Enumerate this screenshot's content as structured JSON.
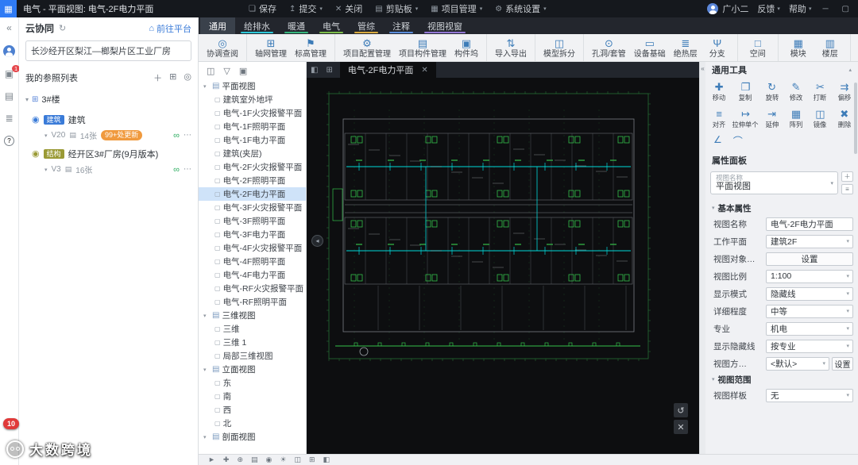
{
  "title_bar": {
    "title": "电气 - 平面视图: 电气-2F电力平面",
    "menu": [
      {
        "label": "保存",
        "icon": "save-icon",
        "caret": false
      },
      {
        "label": "提交",
        "icon": "submit-icon",
        "caret": true
      },
      {
        "label": "关闭",
        "icon": "close-doc-icon",
        "caret": false
      },
      {
        "label": "剪贴板",
        "icon": "clipboard-icon",
        "caret": true
      },
      {
        "label": "项目管理",
        "icon": "project-manage-icon",
        "caret": true
      },
      {
        "label": "系统设置",
        "icon": "system-settings-icon",
        "caret": true
      }
    ],
    "user": "广小二",
    "feedback": "反馈",
    "help": "帮助"
  },
  "ribbon": {
    "tabs": [
      {
        "label": "通用",
        "active": true,
        "underline": ""
      },
      {
        "label": "给排水",
        "active": false,
        "underline": "#2ec8d8"
      },
      {
        "label": "暖通",
        "active": false,
        "underline": "#35b57c"
      },
      {
        "label": "电气",
        "active": false,
        "underline": "#7cbd4a"
      },
      {
        "label": "管综",
        "active": false,
        "underline": "#d8aa3e"
      },
      {
        "label": "注释",
        "active": false,
        "underline": "#5b8ddb"
      },
      {
        "label": "视图视窗",
        "active": false,
        "underline": "#9377d6"
      }
    ],
    "groups": [
      [
        {
          "label": "协调查阅",
          "icon": "coordination-review-icon"
        }
      ],
      [
        {
          "label": "轴网管理",
          "icon": "grid-manage-icon"
        },
        {
          "label": "标高管理",
          "icon": "elevation-manage-icon"
        }
      ],
      [
        {
          "label": "项目配置管理",
          "icon": "project-config-icon"
        },
        {
          "label": "项目构件管理",
          "icon": "project-component-icon"
        },
        {
          "label": "构件坞",
          "icon": "component-dock-icon"
        }
      ],
      [
        {
          "label": "导入导出",
          "icon": "import-export-icon"
        }
      ],
      [
        {
          "label": "模型拆分",
          "icon": "model-split-icon"
        }
      ],
      [
        {
          "label": "孔洞/套管",
          "icon": "hole-sleeve-icon"
        },
        {
          "label": "设备基础",
          "icon": "equipment-base-icon"
        },
        {
          "label": "绝热层",
          "icon": "insulation-icon"
        },
        {
          "label": "分支",
          "icon": "branch-icon"
        }
      ],
      [
        {
          "label": "空间",
          "icon": "space-icon"
        }
      ],
      [
        {
          "label": "模块",
          "icon": "module-icon"
        },
        {
          "label": "楼层",
          "icon": "floor-icon"
        }
      ]
    ]
  },
  "left_strip": {
    "model_badge": "1"
  },
  "cloud_panel": {
    "header": "云协同",
    "go_platform": "前往平台",
    "project_name": "长沙经开区梨江—榔梨片区工业厂房",
    "ref_list_title": "我的参照列表",
    "root": "3#楼",
    "items": [
      {
        "tag": "建筑",
        "tag_color": "#3a7bd8",
        "name": "建筑",
        "version": "V20",
        "sheets": "14张",
        "badge": "99+处更新"
      },
      {
        "tag": "结构",
        "tag_color": "#9a9a35",
        "name": "经开区3#厂房(9月版本)",
        "version": "V3",
        "sheets": "16张",
        "badge": ""
      }
    ]
  },
  "view_tree": {
    "sections": [
      {
        "label": "平面视图",
        "selected": 7,
        "items": [
          "建筑室外地坪",
          "电气-1F火灾报警平面",
          "电气-1F照明平面",
          "电气-1F电力平面",
          "建筑(夹层)",
          "电气-2F火灾报警平面",
          "电气-2F照明平面",
          "电气-2F电力平面",
          "电气-3F火灾报警平面",
          "电气-3F照明平面",
          "电气-3F电力平面",
          "电气-4F火灾报警平面",
          "电气-4F照明平面",
          "电气-4F电力平面",
          "电气-RF火灾报警平面",
          "电气-RF照明平面"
        ]
      },
      {
        "label": "三维视图",
        "selected": -1,
        "items": [
          "三维",
          "三维 1",
          "局部三维视图"
        ]
      },
      {
        "label": "立面视图",
        "selected": -1,
        "items": [
          "东",
          "南",
          "西",
          "北"
        ]
      },
      {
        "label": "剖面视图",
        "selected": -1,
        "items": []
      }
    ]
  },
  "canvas": {
    "tab": "电气-2F电力平面"
  },
  "tools_panel": {
    "header": "通用工具",
    "tools": [
      {
        "label": "移动",
        "icon": "move-icon"
      },
      {
        "label": "复制",
        "icon": "copy-icon"
      },
      {
        "label": "旋转",
        "icon": "rotate-icon"
      },
      {
        "label": "修改",
        "icon": "modify-icon"
      },
      {
        "label": "打断",
        "icon": "break-icon"
      },
      {
        "label": "偏移",
        "icon": "offset-icon"
      },
      {
        "label": "对齐",
        "icon": "align-icon"
      },
      {
        "label": "拉伸单个",
        "icon": "stretch-single-icon"
      },
      {
        "label": "延伸",
        "icon": "extend-icon"
      },
      {
        "label": "阵列",
        "icon": "array-icon"
      },
      {
        "label": "镜像",
        "icon": "mirror-icon"
      },
      {
        "label": "删除",
        "icon": "delete-icon"
      }
    ]
  },
  "properties_panel": {
    "header": "属性面板",
    "selector_label": "视图名称",
    "selector_value": "平面视图",
    "section_basic": "基本属性",
    "rows": [
      {
        "label": "视图名称",
        "value": "电气-2F电力平面",
        "type": "text"
      },
      {
        "label": "工作平面",
        "value": "建筑2F",
        "type": "select"
      },
      {
        "label": "视图对象…",
        "value": "设置",
        "type": "button"
      },
      {
        "label": "视图比例",
        "value": "1:100",
        "type": "select"
      },
      {
        "label": "显示模式",
        "value": "隐藏线",
        "type": "select"
      },
      {
        "label": "详细程度",
        "value": "中等",
        "type": "select"
      },
      {
        "label": "专业",
        "value": "机电",
        "type": "select"
      },
      {
        "label": "显示隐藏线",
        "value": "按专业",
        "type": "select"
      },
      {
        "label": "视图方…",
        "value": "<默认>",
        "type": "select-button",
        "button": "设置"
      }
    ],
    "section_range": "视图范围",
    "rows2": [
      {
        "label": "视图样板",
        "value": "无",
        "type": "select"
      }
    ]
  },
  "status_bar": {
    "icons": [
      "cursor-icon",
      "pan-icon",
      "zoom-icon",
      "layers-icon",
      "visibility-icon",
      "sun-icon",
      "section-icon",
      "grid-icon",
      "split-icon"
    ]
  },
  "watermark": {
    "text": "大数跨境",
    "badge": "10"
  }
}
